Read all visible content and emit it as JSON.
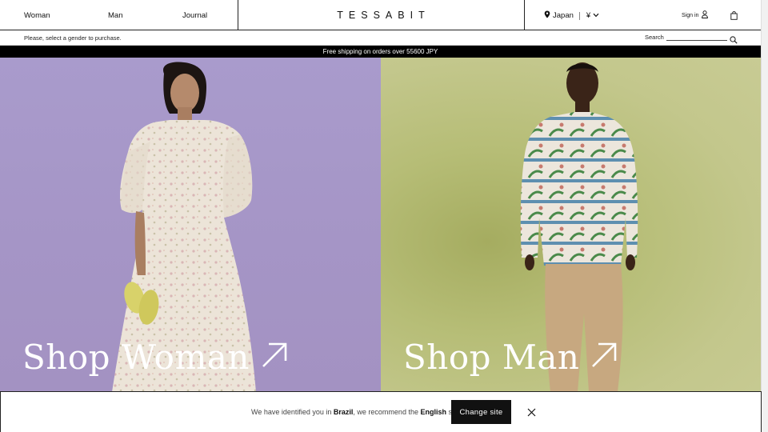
{
  "header": {
    "nav": [
      {
        "label": "Woman"
      },
      {
        "label": "Man"
      },
      {
        "label": "Journal"
      }
    ],
    "logo": "TESSABIT",
    "country": "Japan",
    "currency": "¥",
    "sign_in": "Sign in"
  },
  "subbar": {
    "gender_note": "Please, select a gender to purchase.",
    "search_label": "Search"
  },
  "promo": "Free shipping on orders over 55600 JPY",
  "heroes": [
    {
      "title": "Shop Woman",
      "bg": "#a99bcc"
    },
    {
      "title": "Shop Man",
      "bg": "#b6bd76"
    }
  ],
  "site_banner": {
    "msg_a": "We have identified you in ",
    "country": "Brazil",
    "msg_b": ", we recommend the ",
    "site": "English",
    "msg_c": " site",
    "button": "Change site"
  },
  "icons": [
    "location-pin-icon",
    "chevron-down-icon",
    "user-icon",
    "shopping-bag-icon",
    "search-icon",
    "arrow-up-right-icon",
    "close-icon"
  ]
}
